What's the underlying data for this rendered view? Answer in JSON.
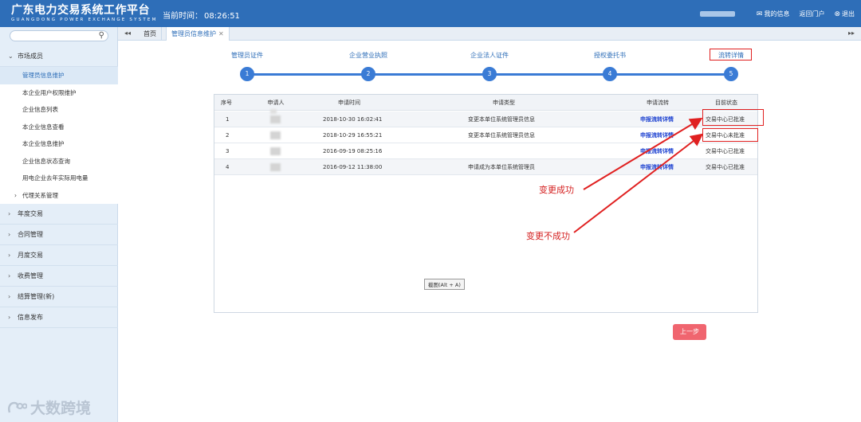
{
  "header": {
    "title": "广东电力交易系统工作平台",
    "subtitle": "GUANGDONG POWER EXCHANGE SYSTEM",
    "time_label": "当前时间：",
    "time_value": "08:26:51",
    "links": [
      {
        "icon": "mail-icon",
        "label": "我的信息"
      },
      {
        "icon": "none",
        "label": "返回门户"
      },
      {
        "icon": "close-circle-icon",
        "label": "退出"
      }
    ]
  },
  "sidebar": {
    "search_placeholder": "",
    "groups": [
      {
        "label": "市场成员",
        "expanded": true
      },
      {
        "label": "年度交易"
      },
      {
        "label": "合同管理"
      },
      {
        "label": "月度交易"
      },
      {
        "label": "收费管理"
      },
      {
        "label": "结算管理(新)"
      },
      {
        "label": "信息发布"
      }
    ],
    "sub_items": [
      {
        "label": "管理员信息维护",
        "active": true
      },
      {
        "label": "本企业用户权限维护"
      },
      {
        "label": "企业信息列表"
      },
      {
        "label": "本企业信息查看"
      },
      {
        "label": "本企业信息维护"
      },
      {
        "label": "企业信息状态查询"
      },
      {
        "label": "用电企业去年实际用电量"
      },
      {
        "label": "代理关系管理"
      }
    ],
    "watermark": "大数跨境"
  },
  "tabs": {
    "home": "首页",
    "active": "管理员信息维护"
  },
  "steps": [
    {
      "label": "管理员证件",
      "number": "1"
    },
    {
      "label": "企业营业执照",
      "number": "2"
    },
    {
      "label": "企业法人证件",
      "number": "3"
    },
    {
      "label": "授权委托书",
      "number": "4"
    },
    {
      "label": "流转详情",
      "number": "5"
    }
  ],
  "table": {
    "columns": [
      "序号",
      "申请人",
      "申请时间",
      "申请类型",
      "申请流转",
      "目前状态"
    ],
    "rows": [
      {
        "no": "1",
        "time": "2018-10-30 16:02:41",
        "type": "变更本单位系统管理员信息",
        "link": "申报流转详情",
        "status": "交易中心已批准"
      },
      {
        "no": "2",
        "time": "2018-10-29 16:55:21",
        "type": "变更本单位系统管理员信息",
        "link": "申报流转详情",
        "status": "交易中心未批准"
      },
      {
        "no": "3",
        "time": "2016-09-19 08:25:16",
        "type": "",
        "link": "申报流转详情",
        "status": "交易中心已批准"
      },
      {
        "no": "4",
        "time": "2016-09-12 11:38:00",
        "type": "申请成为本单位系统管理员",
        "link": "申报流转详情",
        "status": "交易中心已批准"
      }
    ]
  },
  "tooltip": "截图(Alt + A)",
  "annotations": {
    "success": "变更成功",
    "fail": "变更不成功"
  },
  "buttons": {
    "back": "上一步"
  },
  "colors": {
    "header_bg": "#2e6eb8",
    "step_blue": "#3a7bd5",
    "annotation_red": "#d42020",
    "back_button": "#f0656f"
  }
}
